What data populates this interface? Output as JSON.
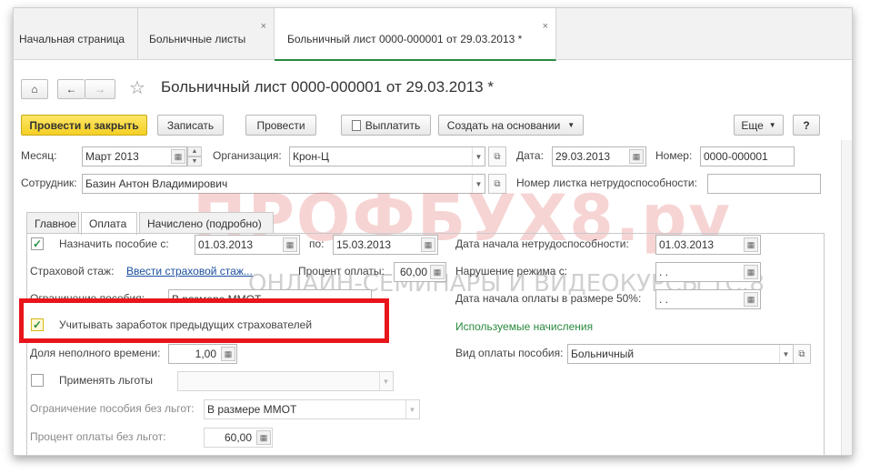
{
  "tabs": [
    {
      "label": "Начальная страница"
    },
    {
      "label": "Больничные листы",
      "close": "×"
    },
    {
      "label": "Больничный лист 0000-000001 от 29.03.2013 *",
      "close": "×"
    }
  ],
  "nav": {
    "home": "⌂",
    "back": "←",
    "forward": "→",
    "star": "☆"
  },
  "header": {
    "title": "Больничный лист 0000-000001 от 29.03.2013 *"
  },
  "toolbar": {
    "post_close": "Провести и закрыть",
    "save": "Записать",
    "post": "Провести",
    "pay": "Выплатить",
    "create_based": "Создать на основании",
    "more": "Еще",
    "help": "?"
  },
  "form": {
    "month_label": "Месяц:",
    "month_value": "Март 2013",
    "org_label": "Организация:",
    "org_value": "Крон-Ц",
    "date_label": "Дата:",
    "date_value": "29.03.2013",
    "number_label": "Номер:",
    "number_value": "0000-000001",
    "employee_label": "Сотрудник:",
    "employee_value": "Базин Антон Владимирович",
    "sheet_number_label": "Номер листка нетрудоспособности:",
    "sheet_number_value": ""
  },
  "subtabs": [
    {
      "label": "Главное"
    },
    {
      "label": "Оплата"
    },
    {
      "label": "Начислено (подробно)"
    }
  ],
  "payment": {
    "assign_label": "Назначить пособие с:",
    "assign_from": "01.03.2013",
    "to_label": "по:",
    "assign_to": "15.03.2013",
    "start_disability_label": "Дата начала нетрудоспособности:",
    "start_disability_value": "01.03.2013",
    "insurance_label": "Страховой стаж:",
    "insurance_link": "Ввести страховой стаж...",
    "percent_label": "Процент оплаты:",
    "percent_value": "60,00",
    "violation_label": "Нарушение режима с:",
    "violation_value": ". .",
    "limit_label": "Ограничение пособия:",
    "limit_value": "В размере ММОТ",
    "start50_label": "Дата начала оплаты в размере 50%:",
    "start50_value": ". .",
    "prev_insurers_label": "Учитывать заработок предыдущих страхователей",
    "used_accruals": "Используемые начисления",
    "part_time_label": "Доля неполного времени:",
    "part_time_value": "1,00",
    "payment_type_label": "Вид оплаты пособия:",
    "payment_type_value": "Больничный",
    "benefits_label": "Применять льготы",
    "benefits_value": "",
    "limit_no_benefits_label": "Ограничение пособия без льгот:",
    "limit_no_benefits_value": "В размере ММОТ",
    "percent_no_benefits_label": "Процент оплаты без льгот:",
    "percent_no_benefits_value": "60,00"
  },
  "watermark": {
    "main": "ПРОФБУХ8.ру",
    "sub": "ОНЛАЙН-СЕМИНАРЫ И ВИДЕОКУРСЫ 1С:8"
  },
  "colors": {
    "accent_green": "#2a8a3e",
    "primary_yellow": "#f4cf24",
    "highlight_red": "#e8151b",
    "link_blue": "#1b4fa0"
  }
}
